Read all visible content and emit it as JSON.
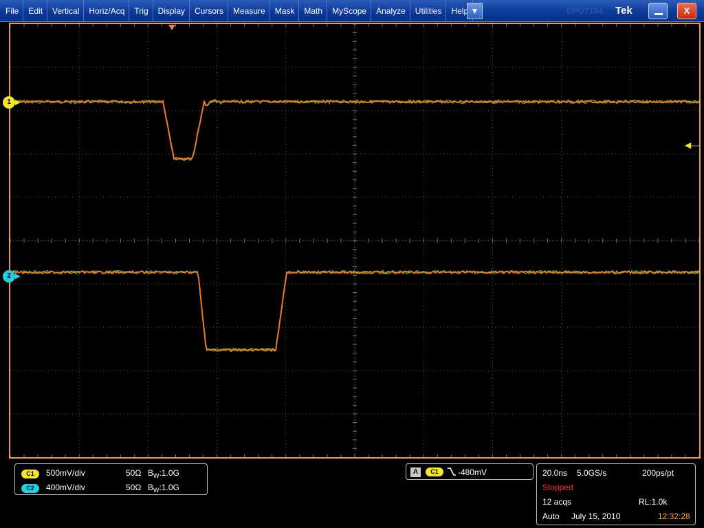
{
  "menu": {
    "items": [
      "File",
      "Edit",
      "Vertical",
      "Horiz/Acq",
      "Trig",
      "Display",
      "Cursors",
      "Measure",
      "Mask",
      "Math",
      "MyScope",
      "Analyze",
      "Utilities",
      "Help"
    ],
    "dropdown_icon": "chevron-down-icon",
    "ghost_title": "DPO7104",
    "brand": "Tek",
    "minimize_label": "",
    "close_label": "X"
  },
  "waveform": {
    "channel_1_marker": "1",
    "channel_2_marker": "2",
    "trace_color": "#f07820",
    "noise_color": "#3cc83c",
    "grid_color": "#5a5a5a",
    "border_color": "#f0a030"
  },
  "vertical": {
    "ch1": {
      "badge": "C1",
      "scale": "500mV/div",
      "impedance": "50Ω",
      "bw_label": "B",
      "bw_sub": "W",
      "bw_value": ":1.0G",
      "color": "#f4e62a"
    },
    "ch2": {
      "badge": "C2",
      "scale": "400mV/div",
      "impedance": "50Ω",
      "bw_label": "B",
      "bw_sub": "W",
      "bw_value": ":1.0G",
      "color": "#22d0e6"
    }
  },
  "trigger": {
    "mode_box": "A",
    "source_badge": "C1",
    "slope_icon": "falling-edge-icon",
    "level": "-480mV"
  },
  "horizontal": {
    "time_per_div": "20.0ns",
    "sample_rate": "5.0GS/s",
    "resolution": "200ps/pt",
    "state": "Stopped",
    "acquisitions": "12 acqs",
    "record_length": "RL:1.0k",
    "trigger_mode": "Auto",
    "date": "July 15, 2010",
    "time": "12:32:28"
  }
}
